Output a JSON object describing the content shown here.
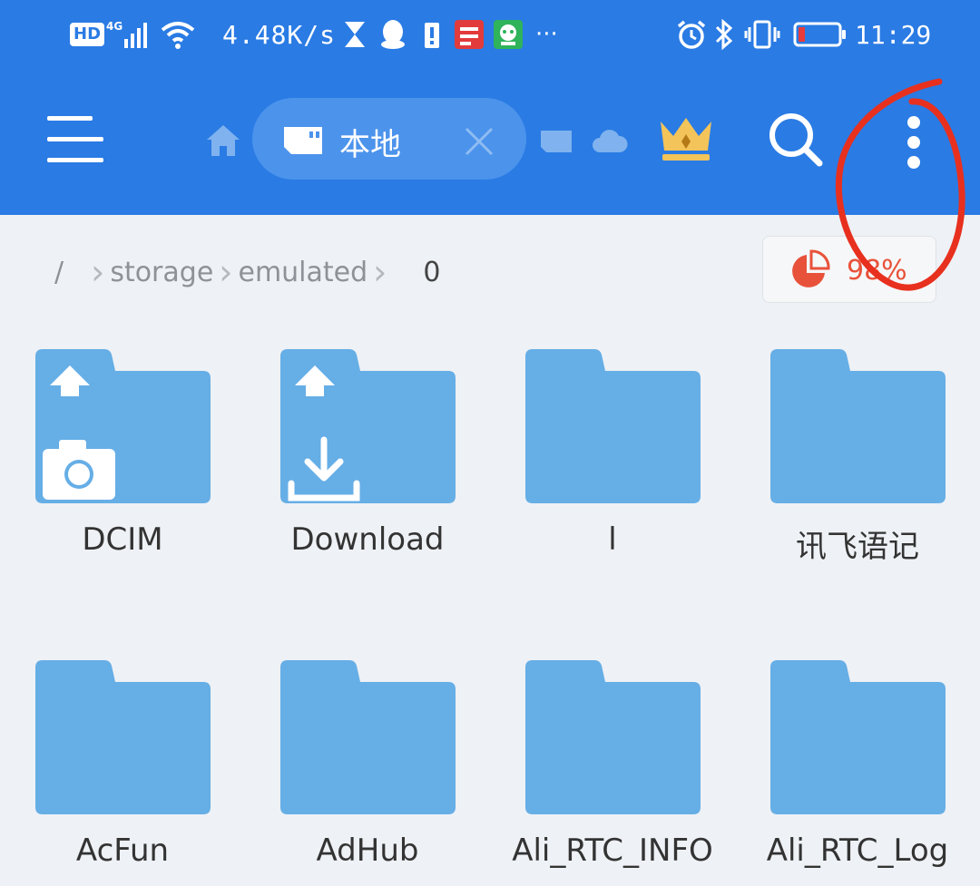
{
  "status_bar": {
    "hd": "HD",
    "network": "4G",
    "speed": "4.48K/s",
    "time": "11:29",
    "more": "···"
  },
  "toolbar": {
    "menu_icon": "hamburger-menu-icon",
    "tab_local_label": "本地",
    "colors": {
      "bar": "#2a7be4",
      "tab": "#4c93ec"
    }
  },
  "breadcrumb": {
    "root": "/",
    "items": [
      "storage",
      "emulated"
    ],
    "current": "0"
  },
  "storage_usage": {
    "percent_text": "98%",
    "color": "#e8523a"
  },
  "folders": [
    {
      "name": "DCIM",
      "overlay": "camera-icon"
    },
    {
      "name": "Download",
      "overlay": "download-icon"
    },
    {
      "name": "l",
      "overlay": ""
    },
    {
      "name": "讯飞语记",
      "overlay": ""
    },
    {
      "name": "AcFun",
      "overlay": ""
    },
    {
      "name": "AdHub",
      "overlay": ""
    },
    {
      "name": "Ali_RTC_INFO",
      "overlay": ""
    },
    {
      "name": "Ali_RTC_Log",
      "overlay": ""
    }
  ],
  "folder_color": "#66aee6"
}
